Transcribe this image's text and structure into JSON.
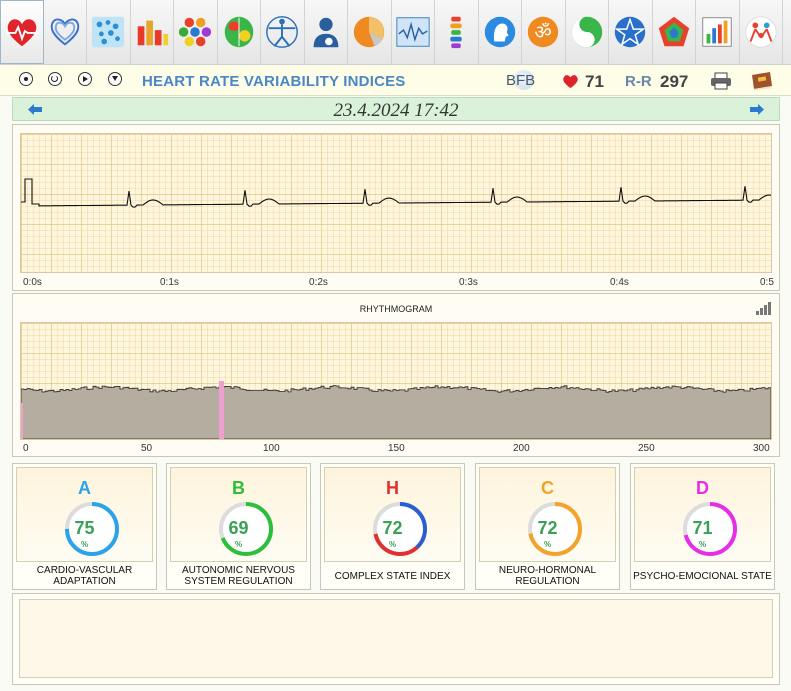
{
  "toolbar": {
    "icons": [
      "heart-icon",
      "hearts-outline-icon",
      "bubbles-icon",
      "bar-chart-icon",
      "hexagon-grid-icon",
      "brain-map-icon",
      "vitruvian-man-icon",
      "doctor-icon",
      "pie-chart-icon",
      "waveform-icon",
      "spine-icon",
      "head-profile-icon",
      "om-icon",
      "yin-yang-icon",
      "star-icon",
      "pentagon-chart-icon",
      "stats-chart-icon",
      "people-logo-icon"
    ]
  },
  "header": {
    "title": "HEART RATE VARIABILITY INDICES",
    "bfb": "BFB",
    "heart_rate": "71",
    "rr_label": "R-R",
    "rr_value": "297"
  },
  "date": "23.4.2024 17:42",
  "ecg": {
    "x_ticks": [
      "0:0s",
      "0:1s",
      "0:2s",
      "0:3s",
      "0:4s",
      "0:5"
    ]
  },
  "rhythmogram": {
    "title": "RHYTHMOGRAM",
    "x_ticks": [
      "0",
      "50",
      "100",
      "150",
      "200",
      "250",
      "300"
    ]
  },
  "indices": [
    {
      "letter": "A",
      "value": "75",
      "pct": "%",
      "label": "CARDIO-VASCULAR ADAPTATION",
      "color": "#2aa3e8"
    },
    {
      "letter": "B",
      "value": "69",
      "pct": "%",
      "label": "AUTONOMIC NERVOUS SYSTEM REGULATION",
      "color": "#2cbf3a"
    },
    {
      "letter": "H",
      "value": "72",
      "pct": "%",
      "label": "COMPLEX STATE INDEX",
      "color": "#e03030"
    },
    {
      "letter": "C",
      "value": "72",
      "pct": "%",
      "label": "NEURO-HORMONAL REGULATION",
      "color": "#f3a22a"
    },
    {
      "letter": "D",
      "value": "71",
      "pct": "%",
      "label": "PSYCHO-EMOCIONAL STATE",
      "color": "#e62ee6"
    }
  ],
  "colors": {
    "title": "#4a87c6",
    "value_green": "#3aa055",
    "date_bar": "#d9f2d9",
    "plot_bg": "#fff6de"
  }
}
